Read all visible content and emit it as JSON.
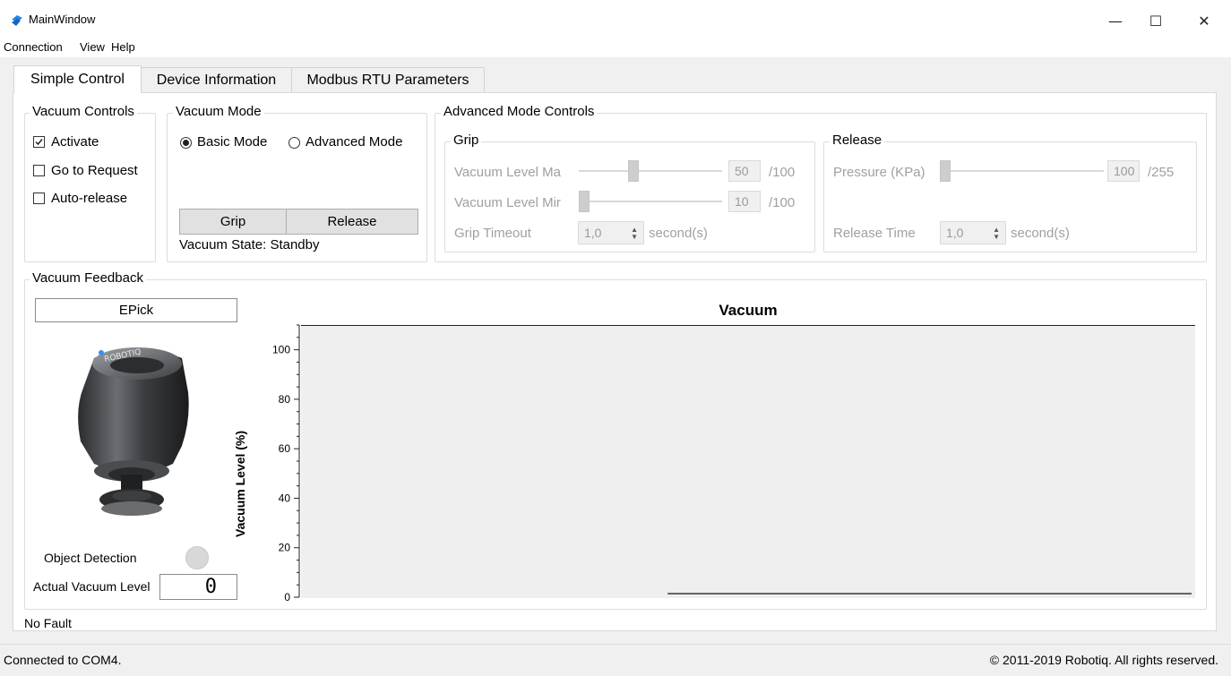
{
  "window": {
    "title": "MainWindow",
    "minimize_icon": "minimize-icon",
    "maximize_icon": "maximize-icon",
    "close_icon": "close-icon"
  },
  "menu": [
    "Connection",
    "View",
    "Help"
  ],
  "tabs": [
    "Simple Control",
    "Device Information",
    "Modbus RTU Parameters"
  ],
  "vacuum_controls": {
    "title": "Vacuum Controls",
    "items": [
      {
        "label": "Activate",
        "checked": true
      },
      {
        "label": "Go to Request",
        "checked": false
      },
      {
        "label": "Auto-release",
        "checked": false
      }
    ]
  },
  "vacuum_mode": {
    "title": "Vacuum Mode",
    "basic": "Basic Mode",
    "advanced": "Advanced Mode",
    "selected": "Basic Mode",
    "grip_button": "Grip",
    "release_button": "Release",
    "state_label": "Vacuum State: Standby"
  },
  "advanced": {
    "title": "Advanced Mode Controls",
    "grip": {
      "title": "Grip",
      "max_label": "Vacuum Level Ma",
      "max_value": "50",
      "max_fraction": 0.5,
      "max_unit": "/100",
      "min_label": "Vacuum Level Mir",
      "min_value": "10",
      "min_fraction": 0.0,
      "min_unit": "/100",
      "timeout_label": "Grip Timeout",
      "timeout_value": "1,0",
      "timeout_unit": "second(s)"
    },
    "release": {
      "title": "Release",
      "pressure_label": "Pressure (KPa)",
      "pressure_value": "100",
      "pressure_unit": "/255",
      "time_label": "Release Time",
      "time_value": "1,0",
      "time_unit": "second(s)"
    }
  },
  "feedback": {
    "title": "Vacuum Feedback",
    "device_name": "EPick",
    "object_detection_label": "Object Detection",
    "actual_vacuum_label": "Actual Vacuum Level",
    "actual_vacuum_value": "0",
    "device_logo_text": "ROBOTIQ"
  },
  "chart_data": {
    "type": "line",
    "title": "Vacuum",
    "xlabel": "",
    "ylabel": "Vacuum Level (%)",
    "ylim": [
      0,
      110
    ],
    "yticks": [
      0,
      20,
      40,
      60,
      80,
      100
    ],
    "grid": false,
    "series": [
      {
        "x_start_fraction": 0.41,
        "x_end_fraction": 1.0,
        "values": [
          0,
          0
        ]
      }
    ]
  },
  "fault_text": "No Fault",
  "status": {
    "left": "Connected to COM4.",
    "right": "© 2011-2019 Robotiq. All rights reserved."
  },
  "colors": {
    "accent": "#1e88e5",
    "disabled_text": "#a0a0a0",
    "plot_bg": "#efefef"
  }
}
